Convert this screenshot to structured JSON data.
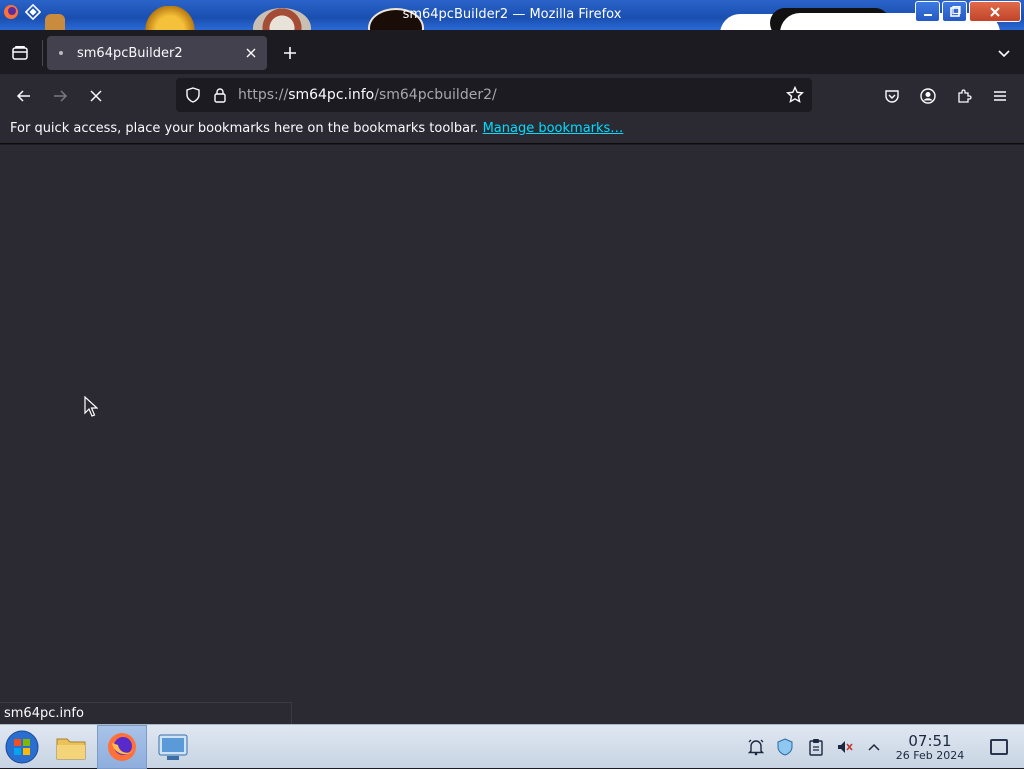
{
  "window": {
    "title": "sm64pcBuilder2 — Mozilla Firefox"
  },
  "tabs": {
    "active": {
      "title": "sm64pcBuilder2"
    }
  },
  "navbar": {
    "url_scheme": "https://",
    "url_host": "sm64pc.info",
    "url_path": "/sm64pcbuilder2/"
  },
  "bookmarks": {
    "message": "For quick access, place your bookmarks here on the bookmarks toolbar.",
    "manage_link": "Manage bookmarks…"
  },
  "status_bar": {
    "text": "sm64pc.info"
  },
  "taskbar": {
    "time": "07:51",
    "date": "26 Feb 2024"
  },
  "colors": {
    "content_bg": "#2b2a33",
    "toolbar_bg": "#2b2a33",
    "tabstrip_bg": "#1c1b22",
    "link": "#00ddff",
    "titlebar": "#2a63c9"
  }
}
